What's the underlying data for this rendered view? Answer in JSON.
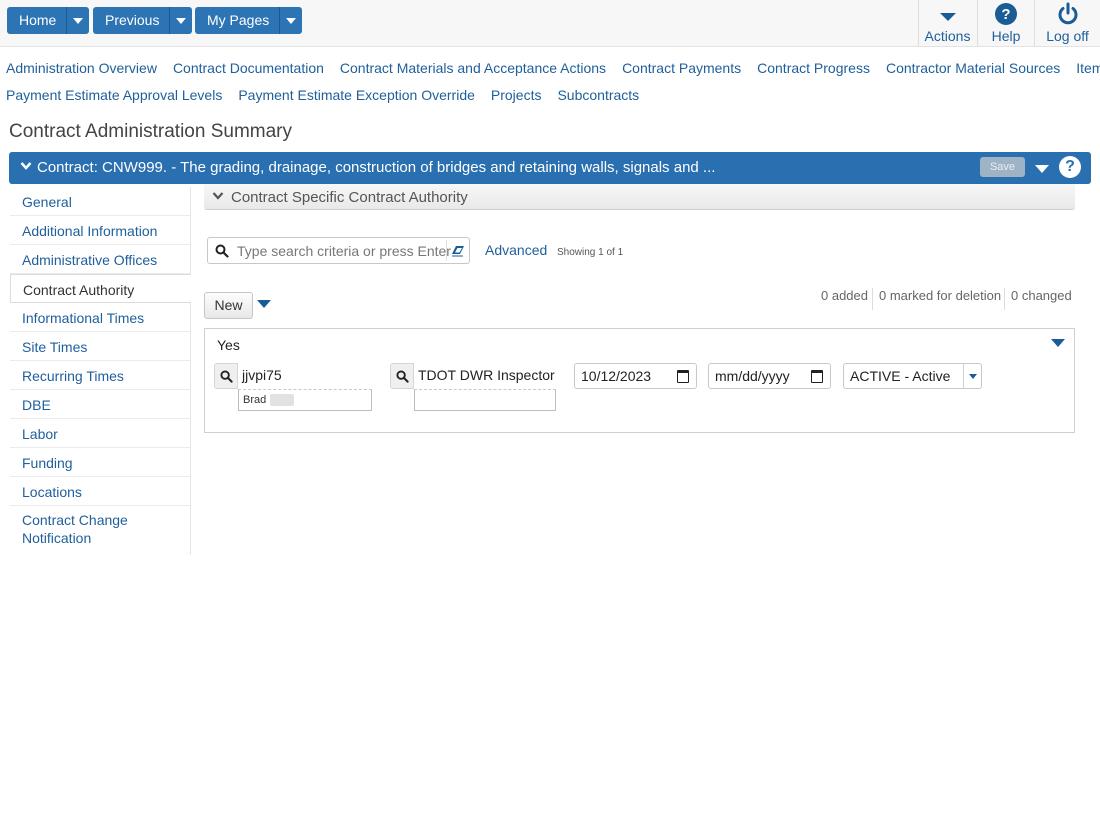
{
  "topbar": {
    "buttons": [
      {
        "label": "Home"
      },
      {
        "label": "Previous"
      },
      {
        "label": "My Pages"
      }
    ],
    "actions": [
      {
        "label": "Actions",
        "icon": "chevron-down-icon"
      },
      {
        "label": "Help",
        "icon": "help-icon"
      },
      {
        "label": "Log off",
        "icon": "power-icon"
      }
    ]
  },
  "nav": {
    "row1": [
      "Administration Overview",
      "Contract Documentation",
      "Contract Materials and Acceptance Actions",
      "Contract Payments",
      "Contract Progress",
      "Contractor Material Sources",
      "Items"
    ],
    "row2": [
      "Payment Estimate Approval Levels",
      "Payment Estimate Exception Override",
      "Projects",
      "Subcontracts"
    ]
  },
  "page": {
    "title": "Contract Administration Summary"
  },
  "contract_bar": {
    "title": "Contract: CNW999. - The grading, drainage, construction of bridges and retaining walls, signals and ...",
    "save_label": "Save",
    "accent": "#2a6fb0"
  },
  "sidebar": {
    "items": [
      "General",
      "Additional Information",
      "Administrative Offices",
      "Contract Authority",
      "Informational Times",
      "Site Times",
      "Recurring Times",
      "DBE",
      "Labor",
      "Funding",
      "Locations",
      "Contract Change Notification"
    ],
    "active": "Contract Authority"
  },
  "section": {
    "title": "Contract Specific Contract Authority"
  },
  "search": {
    "placeholder": "Type search criteria or press Enter",
    "advanced_label": "Advanced",
    "showing": "Showing 1 of 1"
  },
  "toolbar": {
    "new_label": "New",
    "added": "0 added",
    "deleted": "0 marked for deletion",
    "changed": "0 changed"
  },
  "record": {
    "label": "Yes",
    "user_id": "jjvpi75",
    "user_name": "Brad",
    "role": "TDOT DWR Inspector",
    "role_sub": "",
    "start_date": "10/12/2023",
    "end_date_placeholder": "mm/dd/yyyy",
    "status": "ACTIVE - Active"
  }
}
